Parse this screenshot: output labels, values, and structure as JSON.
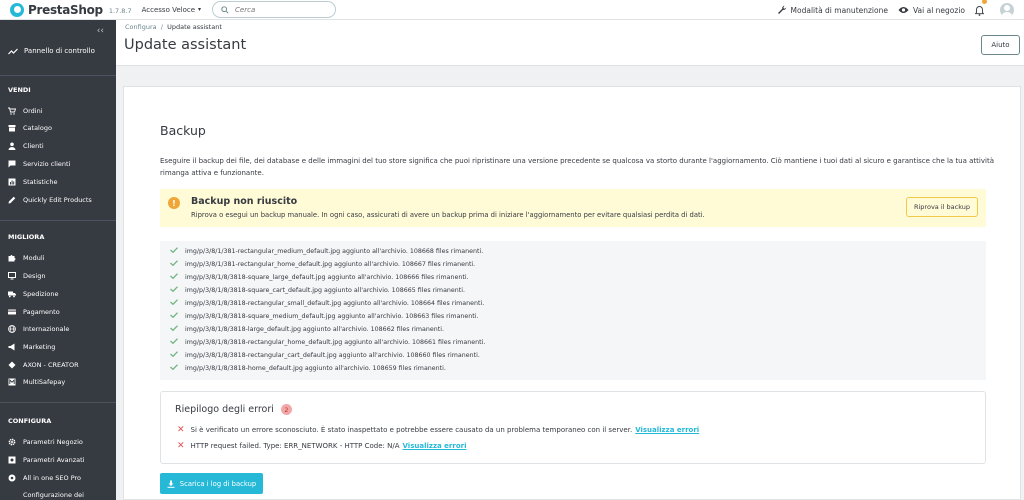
{
  "topbar": {
    "logo": "PrestaShop",
    "version": "1.7.8.7",
    "quick_access": "Accesso Veloce",
    "search_placeholder": "Cerca",
    "maintenance": "Modalità di manutenzione",
    "view_store": "Vai al negozio"
  },
  "sidebar": {
    "dashboard": "Pannello di controllo",
    "sections": [
      {
        "title": "VENDI",
        "items": [
          {
            "label": "Ordini",
            "icon": "cart-icon"
          },
          {
            "label": "Catalogo",
            "icon": "store-icon"
          },
          {
            "label": "Clienti",
            "icon": "user-icon"
          },
          {
            "label": "Servizio clienti",
            "icon": "chat-icon"
          },
          {
            "label": "Statistiche",
            "icon": "chart-icon"
          },
          {
            "label": "Quickly Edit Products",
            "icon": "pencil-icon"
          }
        ]
      },
      {
        "title": "MIGLIORA",
        "items": [
          {
            "label": "Moduli",
            "icon": "puzzle-icon"
          },
          {
            "label": "Design",
            "icon": "monitor-icon"
          },
          {
            "label": "Spedizione",
            "icon": "truck-icon"
          },
          {
            "label": "Pagamento",
            "icon": "card-icon"
          },
          {
            "label": "Internazionale",
            "icon": "globe-icon"
          },
          {
            "label": "Marketing",
            "icon": "megaphone-icon"
          },
          {
            "label": "AXON - CREATOR",
            "icon": "axon-icon"
          },
          {
            "label": "MultiSafepay",
            "icon": "multisafepay-icon"
          }
        ]
      },
      {
        "title": "CONFIGURA",
        "items": [
          {
            "label": "Parametri Negozio",
            "icon": "settings-icon"
          },
          {
            "label": "Parametri Avanzati",
            "icon": "settings-advanced-icon"
          },
          {
            "label": "All in one SEO Pro",
            "icon": "seo-icon"
          },
          {
            "label": "Configurazione dei",
            "icon": "config-icon"
          }
        ]
      }
    ]
  },
  "header": {
    "breadcrumb_parent": "Configura",
    "breadcrumb_separator": "/",
    "breadcrumb_current": "Update assistant",
    "title": "Update assistant",
    "help": "Aiuto"
  },
  "main": {
    "title": "Backup",
    "intro": "Eseguire il backup dei file, dei database e delle immagini del tuo store significa che puoi ripristinare una versione precedente se qualcosa va storto durante l'aggiornamento. Ciò mantiene i tuoi dati al sicuro e garantisce che la tua attività rimanga attiva e funzionante.",
    "alert": {
      "title": "Backup non riuscito",
      "text": "Riprova o esegui un backup manuale. In ogni caso, assicurati di avere un backup prima di iniziare l'aggiornamento per evitare qualsiasi perdita di dati.",
      "retry": "Riprova il backup"
    },
    "log": [
      "img/p/3/8/1/381-rectangular_medium_default.jpg aggiunto all'archivio. 108668 files rimanenti.",
      "img/p/3/8/1/381-rectangular_home_default.jpg aggiunto all'archivio. 108667 files rimanenti.",
      "img/p/3/8/1/8/3818-square_large_default.jpg aggiunto all'archivio. 108666 files rimanenti.",
      "img/p/3/8/1/8/3818-square_cart_default.jpg aggiunto all'archivio. 108665 files rimanenti.",
      "img/p/3/8/1/8/3818-rectangular_small_default.jpg aggiunto all'archivio. 108664 files rimanenti.",
      "img/p/3/8/1/8/3818-square_medium_default.jpg aggiunto all'archivio. 108663 files rimanenti.",
      "img/p/3/8/1/8/3818-large_default.jpg aggiunto all'archivio. 108662 files rimanenti.",
      "img/p/3/8/1/8/3818-rectangular_home_default.jpg aggiunto all'archivio. 108661 files rimanenti.",
      "img/p/3/8/1/8/3818-rectangular_cart_default.jpg aggiunto all'archivio. 108660 files rimanenti.",
      "img/p/3/8/1/8/3818-home_default.jpg aggiunto all'archivio. 108659 files rimanenti."
    ],
    "errors": {
      "title": "Riepilogo degli errori",
      "count": "2",
      "items": [
        {
          "text": "Si è verificato un errore sconosciuto. È stato inaspettato e potrebbe essere causato da un problema temporaneo con il server.",
          "link": "Visualizza errori"
        },
        {
          "text": "HTTP request failed. Type: ERR_NETWORK - HTTP Code: N/A",
          "link": "Visualizza errori"
        }
      ]
    },
    "download": "Scarica i log di backup"
  }
}
